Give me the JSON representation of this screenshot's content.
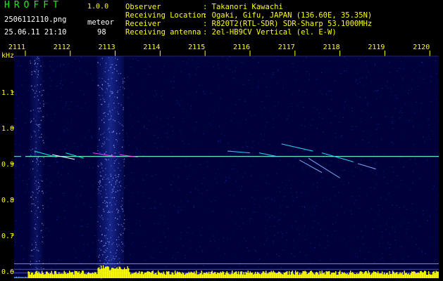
{
  "header": {
    "title": "HROFFT",
    "version": "1.0.0",
    "filename": "2506112110.png",
    "timestamp": "25.06.11 21:10",
    "mode": "meteor",
    "count": "98"
  },
  "info": [
    {
      "label": "Observer",
      "value": ": Takanori Kawachi"
    },
    {
      "label": "Receiving Location",
      "value": ": Ogaki, Gifu, JAPAN (136.60E, 35.35N)"
    },
    {
      "label": "Receiver",
      "value": ": R820T2(RTL-SDR) SDR-Sharp 53.1000MHz"
    },
    {
      "label": "Receiving antenna",
      "value": ": 2el-HB9CV Vertical (el. E-W)"
    }
  ],
  "chart_data": {
    "type": "heatmap",
    "ylabel": "kHz",
    "x_ticks": [
      "2111",
      "2112",
      "2113",
      "2114",
      "2115",
      "2116",
      "2117",
      "2118",
      "2119",
      "2120"
    ],
    "y_ticks": [
      "1.1",
      "1.0",
      "0.9",
      "0.8",
      "0.7",
      "0.6"
    ],
    "ylim": [
      0.58,
      1.2
    ],
    "xlim": [
      2110.75,
      2120.2
    ],
    "carrier_khz": 0.92,
    "colors": {
      "background": "#00003a",
      "noise": "#1a2fb0",
      "carrier": "#7fffd4",
      "echo": "#ff40ff",
      "level": "#ffff00",
      "axis_text": "#ffff00"
    }
  }
}
